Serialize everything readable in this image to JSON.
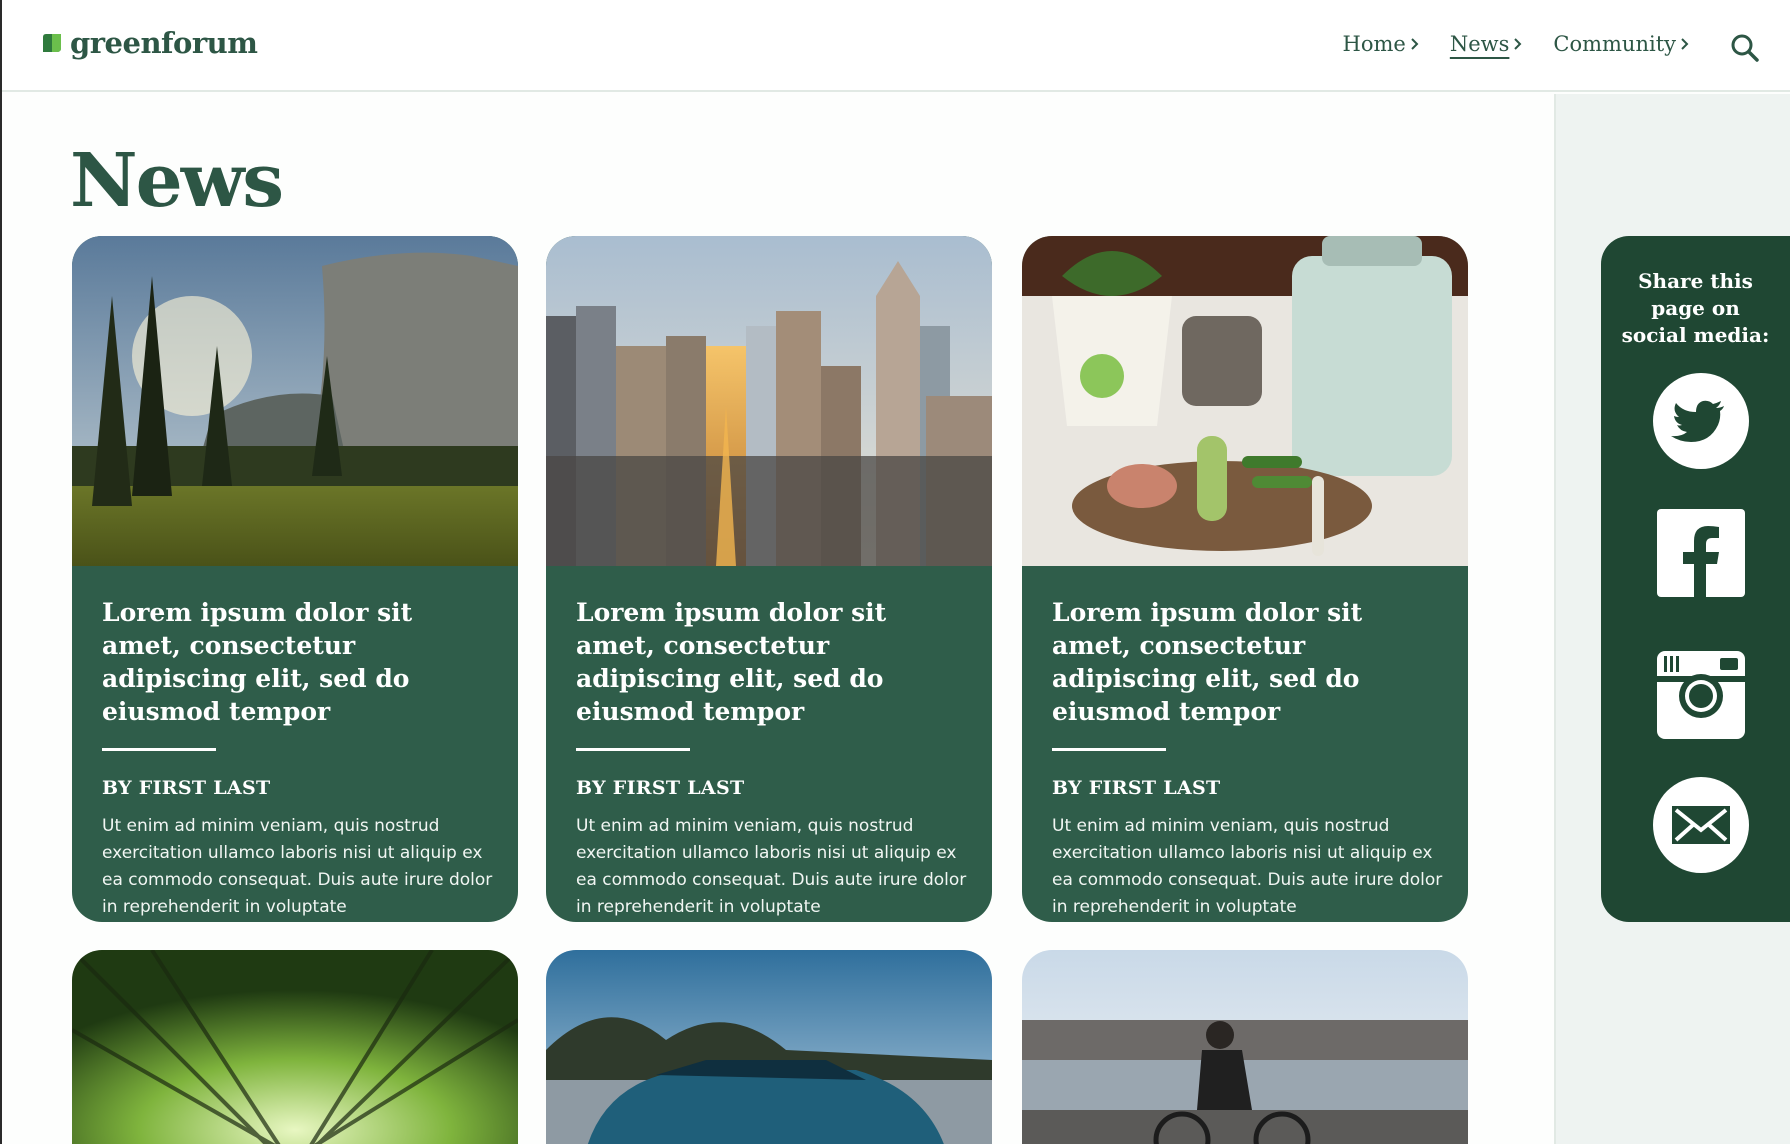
{
  "brand": {
    "name": "greenforum",
    "colors": {
      "primary": "#2d5645",
      "card": "#2f5d4a",
      "share": "#1f4733"
    }
  },
  "nav": {
    "items": [
      {
        "label": "Home",
        "active": false
      },
      {
        "label": "News",
        "active": true
      },
      {
        "label": "Community",
        "active": false
      }
    ],
    "search_icon": "search-icon"
  },
  "page": {
    "title": "News"
  },
  "articles": [
    {
      "image": "mountain-forest-photo",
      "title": "Lorem ipsum dolor sit amet, consectetur adipiscing elit, sed do eiusmod tempor",
      "byline": "BY FIRST LAST",
      "excerpt": "Ut enim ad minim veniam, quis nostrud exercitation ullamco laboris nisi ut aliquip ex ea commodo consequat. Duis aute irure dolor in reprehenderit in voluptate"
    },
    {
      "image": "city-skyline-photo",
      "title": "Lorem ipsum dolor sit amet, consectetur adipiscing elit, sed do eiusmod tempor",
      "byline": "BY FIRST LAST",
      "excerpt": "Ut enim ad minim veniam, quis nostrud exercitation ullamco laboris nisi ut aliquip ex ea commodo consequat. Duis aute irure dolor in reprehenderit in voluptate"
    },
    {
      "image": "compost-vegetables-photo",
      "title": "Lorem ipsum dolor sit amet, consectetur adipiscing elit, sed do eiusmod tempor",
      "byline": "BY FIRST LAST",
      "excerpt": "Ut enim ad minim veniam, quis nostrud exercitation ullamco laboris nisi ut aliquip ex ea commodo consequat. Duis aute irure dolor in reprehenderit in voluptate"
    }
  ],
  "articles_row2": [
    {
      "image": "bamboo-canopy-photo"
    },
    {
      "image": "blue-car-photo"
    },
    {
      "image": "cyclist-photo"
    }
  ],
  "share": {
    "title": "Share this page on social media:",
    "icons": [
      "twitter-icon",
      "facebook-icon",
      "instagram-icon",
      "email-icon"
    ]
  }
}
